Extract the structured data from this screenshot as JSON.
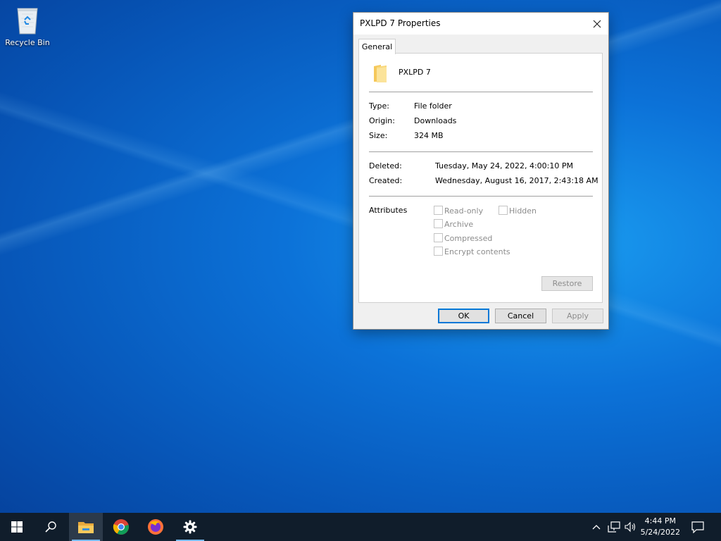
{
  "desktop": {
    "recycle_bin_label": "Recycle Bin"
  },
  "dialog": {
    "title": "PXLPD 7 Properties",
    "tab_general": "General",
    "folder_name": "PXLPD 7",
    "type_label": "Type:",
    "type_value": "File folder",
    "origin_label": "Origin:",
    "origin_value": "Downloads",
    "size_label": "Size:",
    "size_value": "324 MB",
    "deleted_label": "Deleted:",
    "deleted_value": "Tuesday, May 24, 2022, 4:00:10 PM",
    "created_label": "Created:",
    "created_value": "Wednesday, August 16, 2017, 2:43:18 AM",
    "attributes_label": "Attributes",
    "attributes": {
      "read_only": {
        "label": "Read-only",
        "checked": false
      },
      "hidden": {
        "label": "Hidden",
        "checked": false
      },
      "archive": {
        "label": "Archive",
        "checked": false
      },
      "compressed": {
        "label": "Compressed",
        "checked": false
      },
      "encrypt": {
        "label": "Encrypt contents",
        "checked": false
      }
    },
    "restore_label": "Restore",
    "ok_label": "OK",
    "cancel_label": "Cancel",
    "apply_label": "Apply"
  },
  "taskbar": {
    "items": [
      "windows-start-icon",
      "search-icon",
      "file-explorer-icon",
      "chrome-icon",
      "firefox-icon",
      "settings-icon"
    ],
    "time": "4:44 PM",
    "date": "5/24/2022"
  },
  "colors": {
    "accent": "#0078d7",
    "taskbar": "#101d2b",
    "desktop": "#0c72d8"
  }
}
